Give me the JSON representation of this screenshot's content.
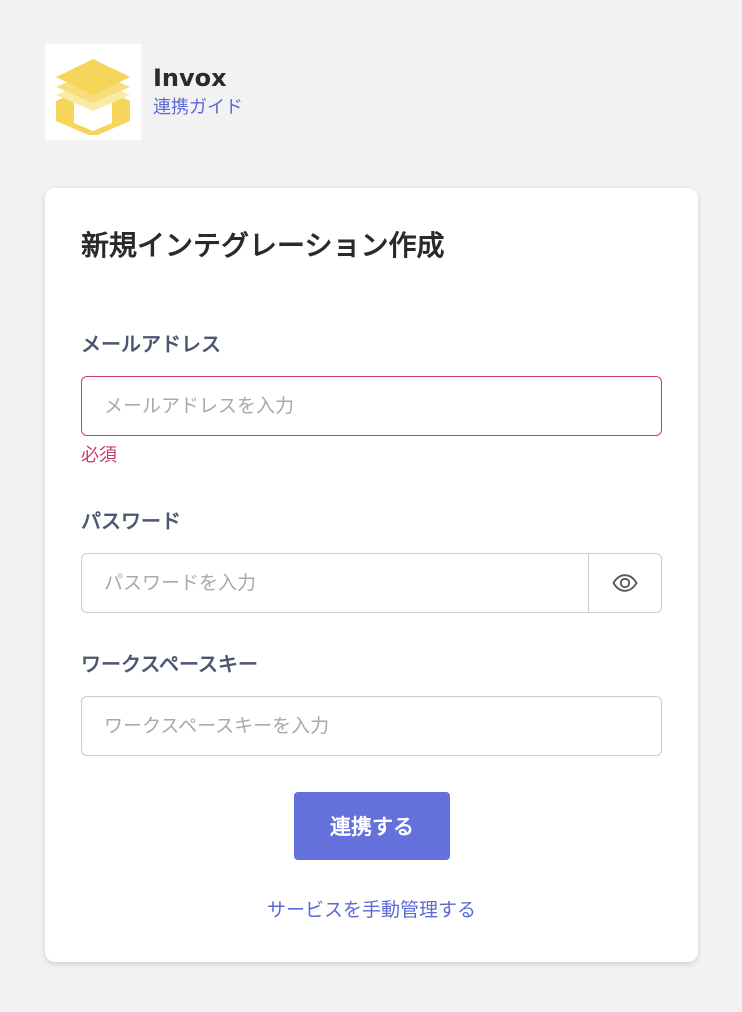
{
  "brand": {
    "name": "Invox",
    "guide_link": "連携ガイド"
  },
  "form": {
    "title": "新規インテグレーション作成",
    "email": {
      "label": "メールアドレス",
      "placeholder": "メールアドレスを入力",
      "error": "必須"
    },
    "password": {
      "label": "パスワード",
      "placeholder": "パスワードを入力"
    },
    "workspace_key": {
      "label": "ワークスペースキー",
      "placeholder": "ワークスペースキーを入力"
    },
    "submit_label": "連携する",
    "manual_link": "サービスを手動管理する"
  },
  "colors": {
    "background": "#f2f2f2",
    "accent": "#6470db",
    "link": "#5a6ad3",
    "error": "#c63d6d",
    "logo_yellow": "#f5d65a"
  },
  "icons": {
    "logo": "box-logo-icon",
    "password_toggle": "eye-icon"
  }
}
